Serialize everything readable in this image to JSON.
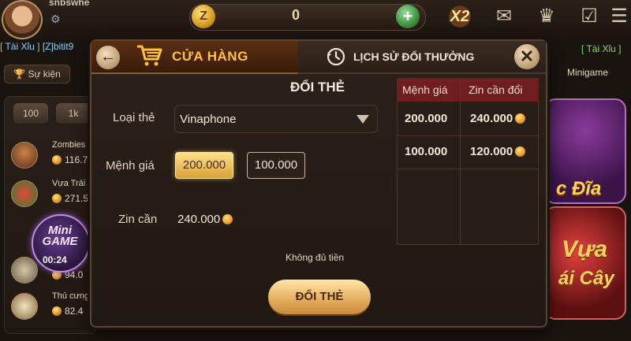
{
  "topbar": {
    "username": "snbswhe",
    "coin_value": "0",
    "coin_symbol": "Z",
    "plus_symbol": "+",
    "boost_label": "X2"
  },
  "ticker": {
    "left_game": "Tài Xỉu",
    "left_user": "[Z]bitit9",
    "right_game": "Tài Xỉu"
  },
  "lobby": {
    "event_tab": "Sự kiện",
    "minigame_tab": "Minigame",
    "chips": [
      "100",
      "1k"
    ],
    "leaderboard": [
      {
        "name": "Zombies",
        "amount": "116.7"
      },
      {
        "name": "Vựa Trái",
        "amount": "271.5"
      },
      {
        "name": "",
        "amount": ""
      },
      {
        "name": "",
        "amount": "94.0"
      },
      {
        "name": "Thú cưng",
        "amount": "82.4"
      }
    ],
    "minigame_label": "Mini GAME",
    "minigame_timer": "00:24",
    "card_xocdia": "c Đĩa",
    "card_vua_1": "Vựa",
    "card_vua_2": "ái Cây"
  },
  "modal": {
    "shop_title": "CỬA HÀNG",
    "history_title": "LỊCH SỬ ĐỔI THƯỞNG",
    "form_title": "ĐỔI THẺ",
    "card_type_label": "Loại thẻ",
    "card_type_value": "Vinaphone",
    "denomination_label": "Mệnh giá",
    "denominations": [
      "200.000",
      "100.000"
    ],
    "selected_denomination": "200.000",
    "zin_label": "Zin cần",
    "zin_value": "240.000",
    "notice": "Không đủ tiền",
    "submit_label": "ĐỔI THẺ",
    "rate_table": {
      "headers": [
        "Mệnh giá",
        "Zin cần đổi"
      ],
      "rows": [
        [
          "200.000",
          "240.000"
        ],
        [
          "100.000",
          "120.000"
        ]
      ]
    }
  },
  "colors": {
    "accent_gold": "#ffc23a",
    "table_header": "#6e1e1e",
    "ticker_blue": "#7fd1ff",
    "ticker_green": "#8bdc5c"
  }
}
